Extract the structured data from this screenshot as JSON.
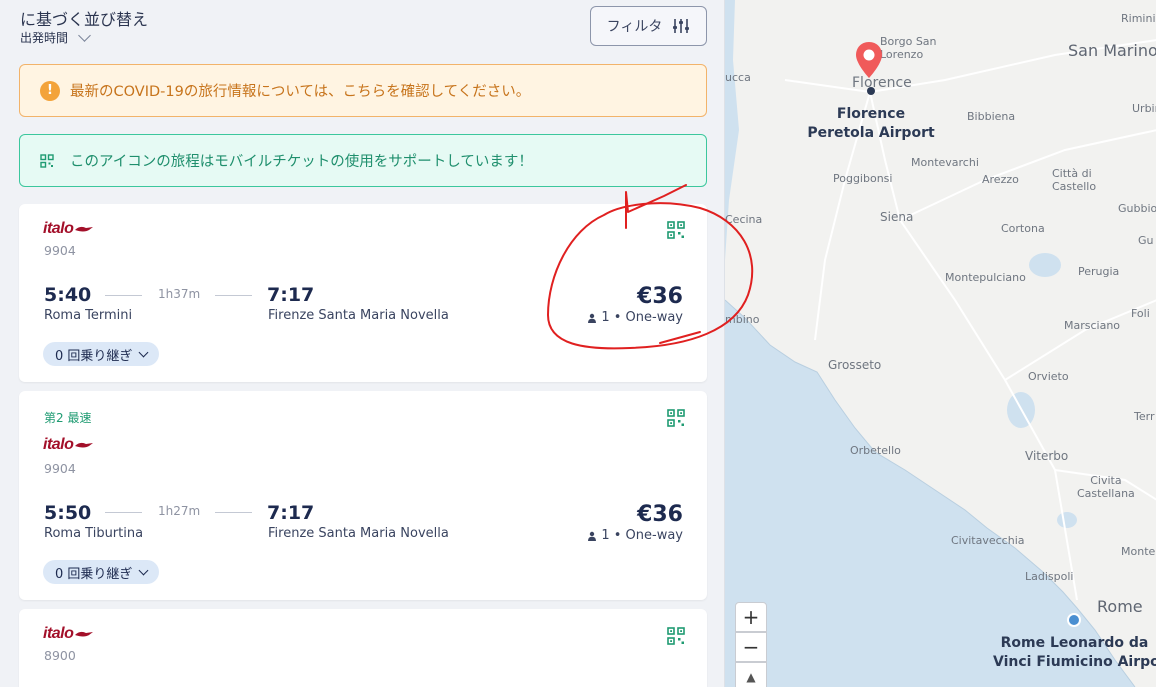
{
  "sort": {
    "title": "に基づく並び替え",
    "value": "出発時間"
  },
  "filter": {
    "label": "フィルタ",
    "icon": "sliders-icon"
  },
  "banners": {
    "covid": {
      "text": "最新のCOVID-19の旅行情報については、こちらを確認してください。",
      "icon": "warning-icon"
    },
    "mobile": {
      "text": "このアイコンの旅程はモバイルチケットの使用をサポートしています！",
      "icon": "qr-code-icon"
    }
  },
  "results": [
    {
      "operator": "italo",
      "train": "9904",
      "tag": "",
      "depart_time": "5:40",
      "depart_station": "Roma Termini",
      "duration": "1h37m",
      "arrive_time": "7:17",
      "arrive_station": "Firenze Santa Maria Novella",
      "price": "€36",
      "passengers": "1 • One-way",
      "transfers": "0 回乗り継ぎ"
    },
    {
      "operator": "italo",
      "train": "9904",
      "tag": "第2 最速",
      "depart_time": "5:50",
      "depart_station": "Roma Tiburtina",
      "duration": "1h27m",
      "arrive_time": "7:17",
      "arrive_station": "Firenze Santa Maria Novella",
      "price": "€36",
      "passengers": "1 • One-way",
      "transfers": "0 回乗り継ぎ"
    },
    {
      "operator": "italo",
      "train": "8900"
    }
  ],
  "map": {
    "labels": {
      "rimini": "Rimini",
      "san_marino": "San Marino",
      "borgo": "Borgo San\nLorenzo",
      "lucca": "ucca",
      "florence": "Florence",
      "bibbiena": "Bibbiena",
      "urbino": "Urbin",
      "montevarchi": "Montevarchi",
      "poggibonsi": "Poggibonsi",
      "arezzo": "Arezzo",
      "citta": "Città di\nCastello",
      "cecina": "Cecina",
      "siena": "Siena",
      "gubbio": "Gubbio",
      "cortona": "Cortona",
      "gu": "Gu",
      "montepulciano": "Montepulciano",
      "perugia": "Perugia",
      "piombino": "mbino",
      "foli": "Foli",
      "marsciano": "Marsciano",
      "grosseto": "Grosseto",
      "orvieto": "Orvieto",
      "ter": "Terr",
      "orbetello": "Orbetello",
      "viterbo": "Viterbo",
      "civita": "Civita\nCastellana",
      "civitavecchia": "Civitavecchia",
      "montero": "Montero",
      "ladispoli": "Ladispoli",
      "rome": "Rome"
    },
    "airports": {
      "origin": "Florence\nPeretola Airport",
      "destination": "Rome Leonardo da\nVinci Fiumicino Airport"
    },
    "zoom_in": "+",
    "zoom_out": "−",
    "compass": "▲"
  },
  "colors": {
    "accent": "#1d2a4f",
    "italo": "#a3102a",
    "mobile": "#1f9b72",
    "annotation": "#e02020"
  }
}
